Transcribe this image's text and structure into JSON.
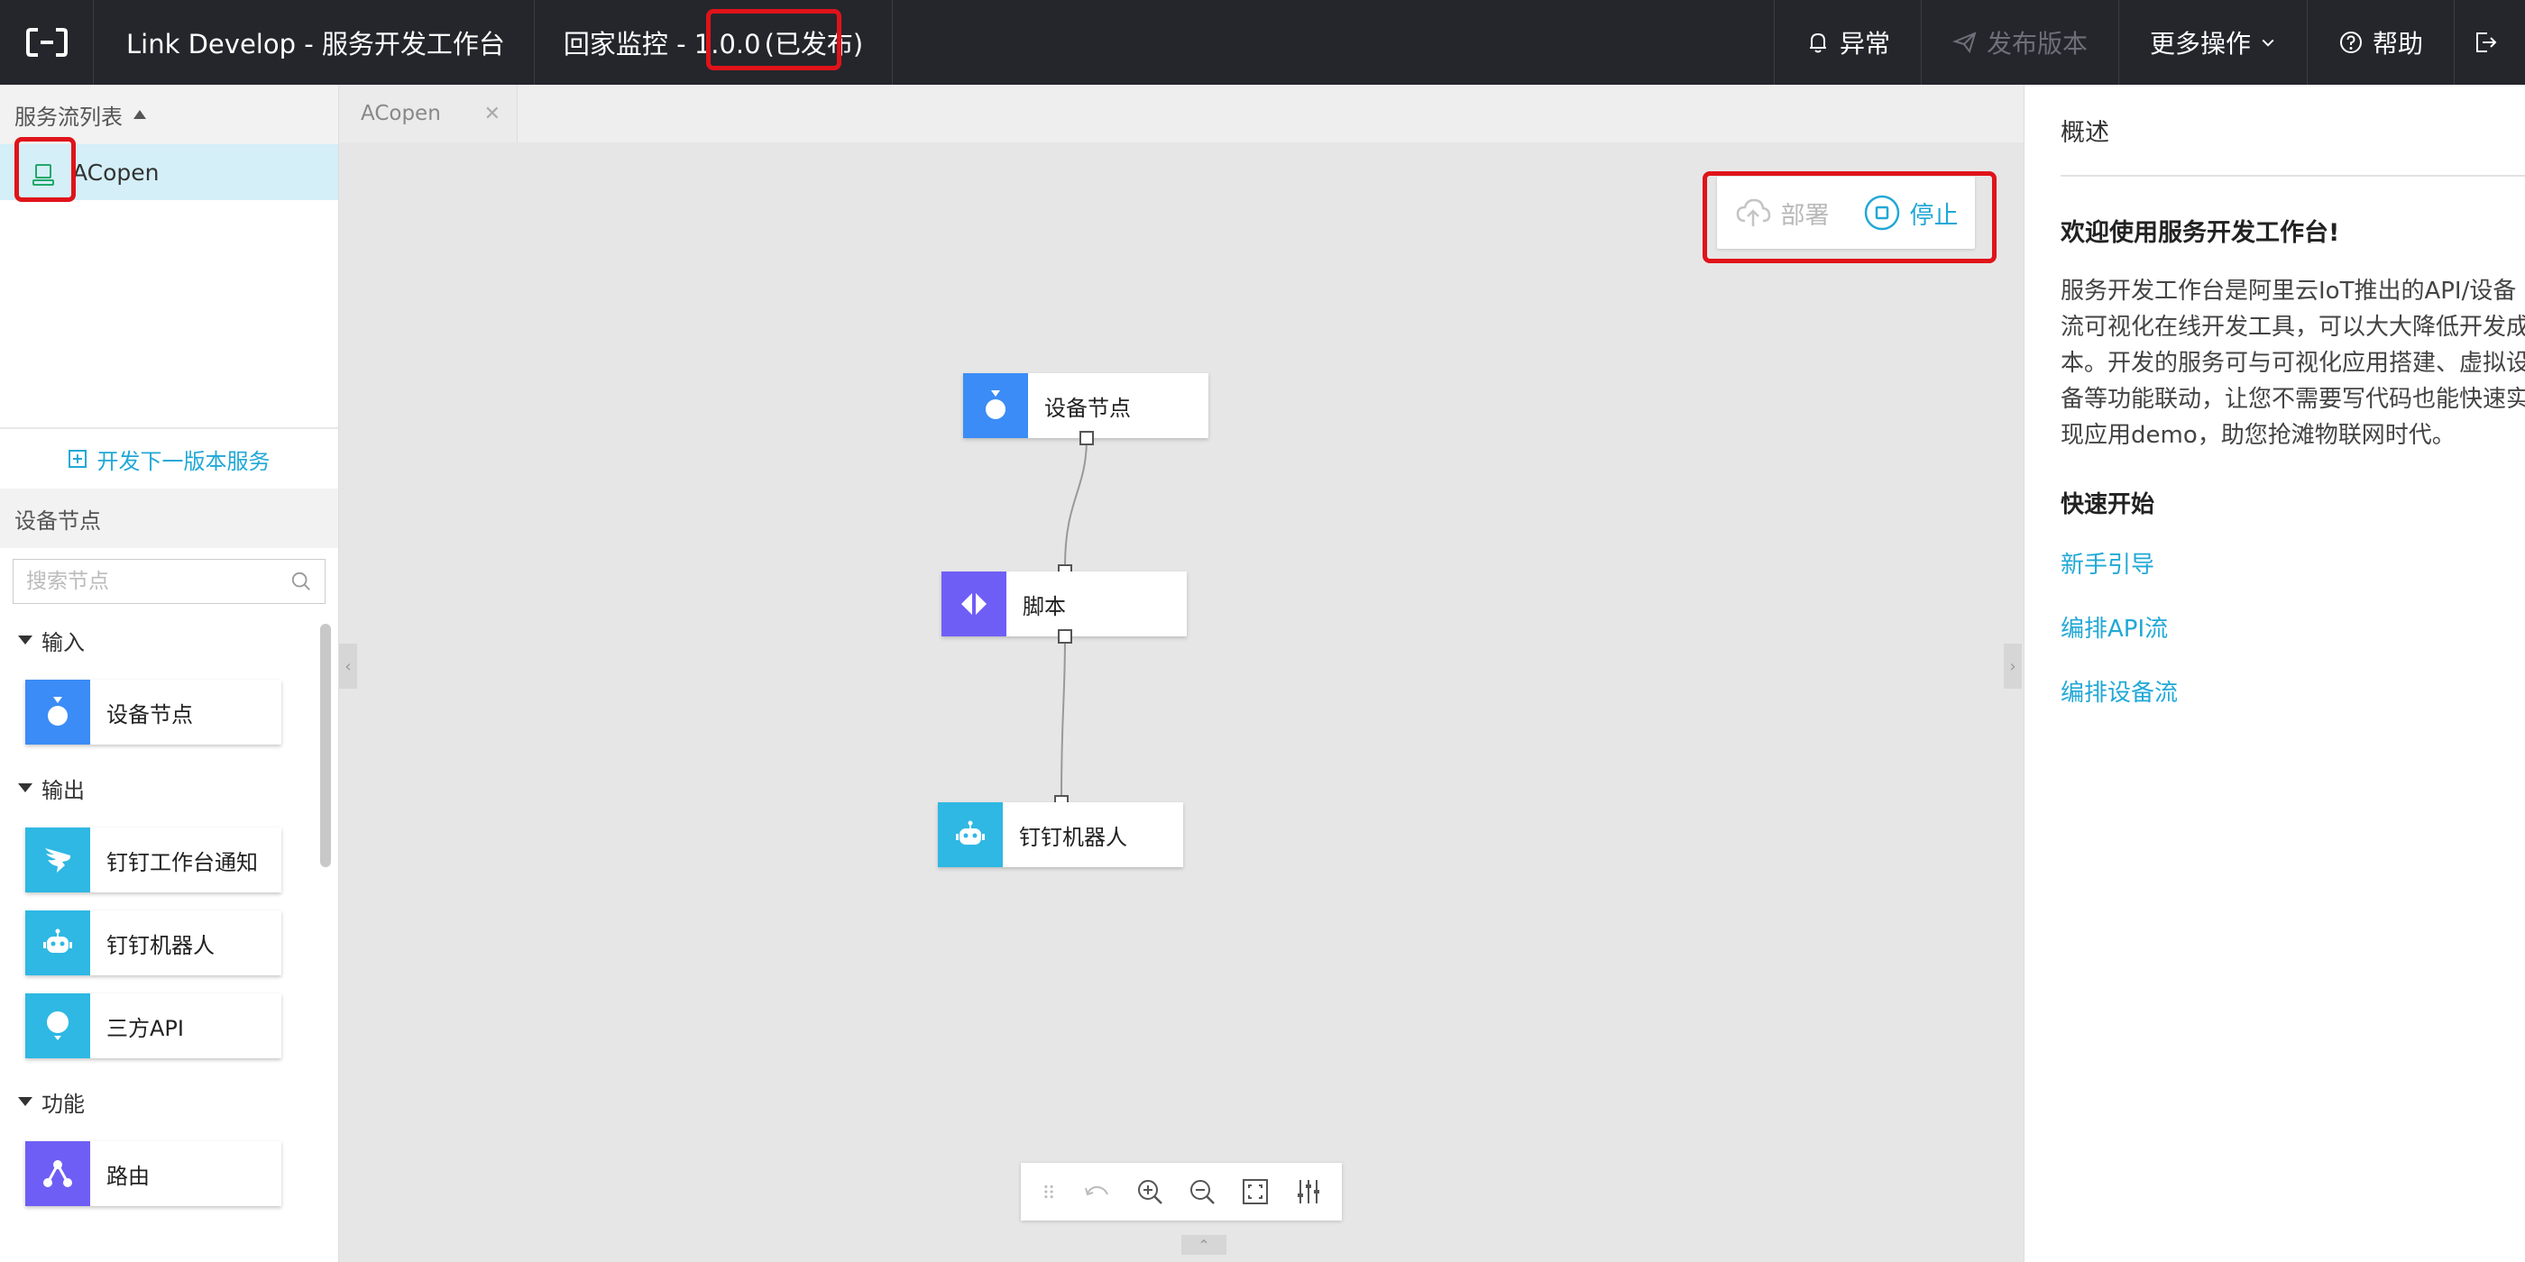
{
  "header": {
    "app_title": "Link Develop - 服务开发工作台",
    "project": "回家监控 - 1.0.0",
    "status": "(已发布)",
    "buttons": {
      "alerts": "异常",
      "publish": "发布版本",
      "more": "更多操作",
      "help": "帮助"
    }
  },
  "left_panel": {
    "flow_list_title": "服务流列表",
    "flow_items": [
      {
        "label": "ACopen"
      }
    ],
    "new_version": "开发下一版本服务",
    "nodes_section": "设备节点",
    "search_placeholder": "搜索节点",
    "categories": [
      {
        "label": "输入",
        "nodes": [
          {
            "label": "设备节点",
            "icon": "device-icon",
            "color": "#3b8cf6"
          }
        ]
      },
      {
        "label": "输出",
        "nodes": [
          {
            "label": "钉钉工作台通知",
            "icon": "dingtalk-icon",
            "color": "#2eb8e3"
          },
          {
            "label": "钉钉机器人",
            "icon": "robot-icon",
            "color": "#2eb8e3"
          },
          {
            "label": "三方API",
            "icon": "balloon-icon",
            "color": "#2eb8e3"
          }
        ]
      },
      {
        "label": "功能",
        "nodes": [
          {
            "label": "路由",
            "icon": "router-icon",
            "color": "#6f5ef5"
          }
        ]
      }
    ]
  },
  "canvas": {
    "tab": "ACopen",
    "deploy": "部署",
    "stop": "停止",
    "nodes": [
      {
        "label": "设备节点",
        "icon": "device-icon",
        "color": "#3b8cf6"
      },
      {
        "label": "脚本",
        "icon": "script-icon",
        "color": "#6f5ef5"
      },
      {
        "label": "钉钉机器人",
        "icon": "robot-icon",
        "color": "#2eb8e3"
      }
    ]
  },
  "right_panel": {
    "title": "概述",
    "welcome": "欢迎使用服务开发工作台!",
    "description": "服务开发工作台是阿里云IoT推出的API/设备流可视化在线开发工具，可以大大降低开发成本。开发的服务可与可视化应用搭建、虚拟设备等功能联动，让您不需要写代码也能快速实现应用demo，助您抢滩物联网时代。",
    "quick_start": "快速开始",
    "links": [
      "新手引导",
      "编排API流",
      "编排设备流"
    ]
  },
  "colors": {
    "accent": "#21a8d6",
    "highlight": "#e0131a",
    "topbar": "#24262c"
  }
}
